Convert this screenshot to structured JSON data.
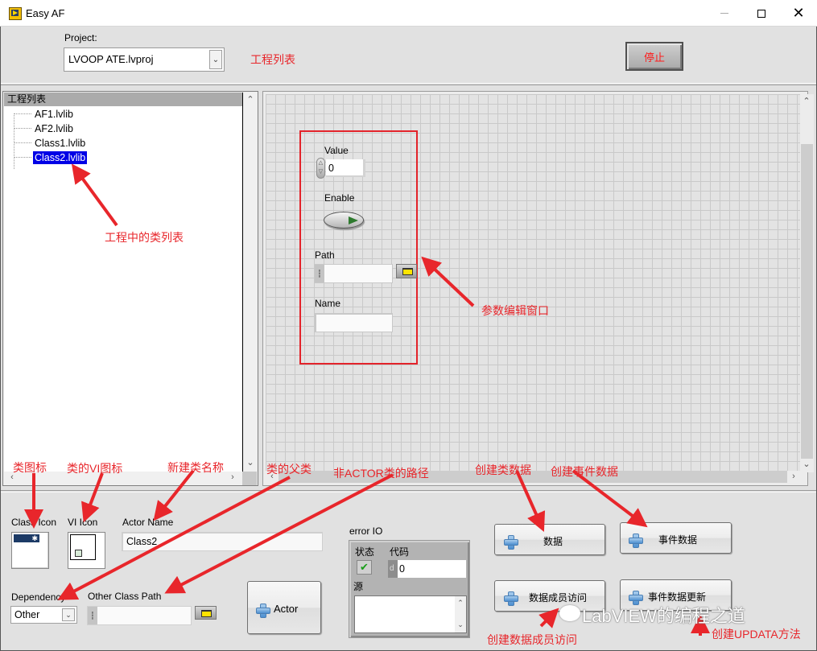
{
  "window": {
    "title": "Easy AF",
    "minimize_glyph": "—",
    "close_glyph": "✕"
  },
  "project": {
    "label": "Project:",
    "value": "LVOOP ATE.lvproj",
    "arrow": "⌄"
  },
  "stop_button": {
    "label": "停止"
  },
  "tree": {
    "header": "工程列表",
    "items": [
      {
        "label": "AF1.lvlib",
        "selected": false
      },
      {
        "label": "AF2.lvlib",
        "selected": false
      },
      {
        "label": "Class1.lvlib",
        "selected": false
      },
      {
        "label": "Class2.lvlib",
        "selected": true
      }
    ]
  },
  "params": {
    "value": {
      "label": "Value",
      "value": "0"
    },
    "enable": {
      "label": "Enable",
      "value": true
    },
    "path": {
      "label": "Path",
      "value": ""
    },
    "name": {
      "label": "Name",
      "value": ""
    }
  },
  "bottom": {
    "class_icon": {
      "label": "Class Icon",
      "glyph": "✱"
    },
    "vi_icon": {
      "label": "VI Icon"
    },
    "actor_name": {
      "label": "Actor Name",
      "value": "Class2"
    },
    "dependency": {
      "label": "Dependency",
      "value": "Other"
    },
    "other_class_path": {
      "label": "Other Class Path",
      "value": ""
    },
    "actor_button": {
      "label": "Actor"
    },
    "error_io": {
      "label": "error IO",
      "status_label": "状态",
      "status_glyph": "✔",
      "code_label": "代码",
      "code_prefix": "d",
      "code_value": "0",
      "source_label": "源",
      "source_value": ""
    },
    "buttons": {
      "data": "数据",
      "event_data": "事件数据",
      "member_access": "数据成员访问",
      "event_data_update": "事件数据更新"
    }
  },
  "annotations": {
    "project_list": "工程列表",
    "class_list": "工程中的类列表",
    "param_window": "参数编辑窗口",
    "class_icon": "类图标",
    "vi_icon": "类的VI图标",
    "new_class_name": "新建类名称",
    "parent_class": "类的父类",
    "non_actor_path": "非ACTOR类的路径",
    "create_class_data": "创建类数据",
    "create_event_data": "创建事件数据",
    "create_member_access": "创建数据成员访问",
    "create_update_method": "创建UPDATA方法"
  },
  "watermark": "LabVIEW的编程之道",
  "colors": {
    "annotation": "#e8262b",
    "selection": "#0000e6",
    "stop_text": "#ff1a1a"
  }
}
